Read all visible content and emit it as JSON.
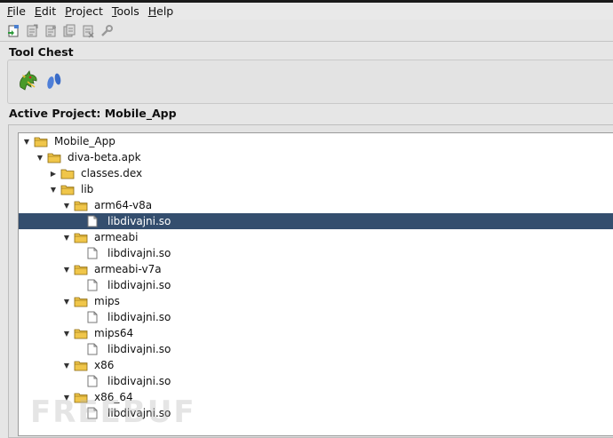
{
  "menu": [
    "File",
    "Edit",
    "Project",
    "Tools",
    "Help"
  ],
  "toolbar": {
    "icons": [
      "new-project-icon",
      "import-file-icon",
      "export-icon",
      "batch-import-icon",
      "delete-icon",
      "settings-icon"
    ]
  },
  "tool_chest": {
    "title": "Tool Chest",
    "tools": [
      "codebrowser-dragon-icon",
      "version-tracking-footprints-icon"
    ]
  },
  "active_project": {
    "title": "Active Project: Mobile_App"
  },
  "tree": {
    "root": "Mobile_App",
    "apk": "diva-beta.apk",
    "classes": "classes.dex",
    "lib": "lib",
    "folders": [
      {
        "name": "arm64-v8a",
        "file": "libdivajni.so",
        "selected": true
      },
      {
        "name": "armeabi",
        "file": "libdivajni.so"
      },
      {
        "name": "armeabi-v7a",
        "file": "libdivajni.so"
      },
      {
        "name": "mips",
        "file": "libdivajni.so"
      },
      {
        "name": "mips64",
        "file": "libdivajni.so"
      },
      {
        "name": "x86",
        "file": "libdivajni.so"
      },
      {
        "name": "x86_64",
        "file": "libdivajni.so"
      }
    ]
  },
  "watermark": "FREEBUF",
  "colors": {
    "selection": "#344e6e",
    "folder": "#e8b83a",
    "background": "#e6e6e6"
  }
}
